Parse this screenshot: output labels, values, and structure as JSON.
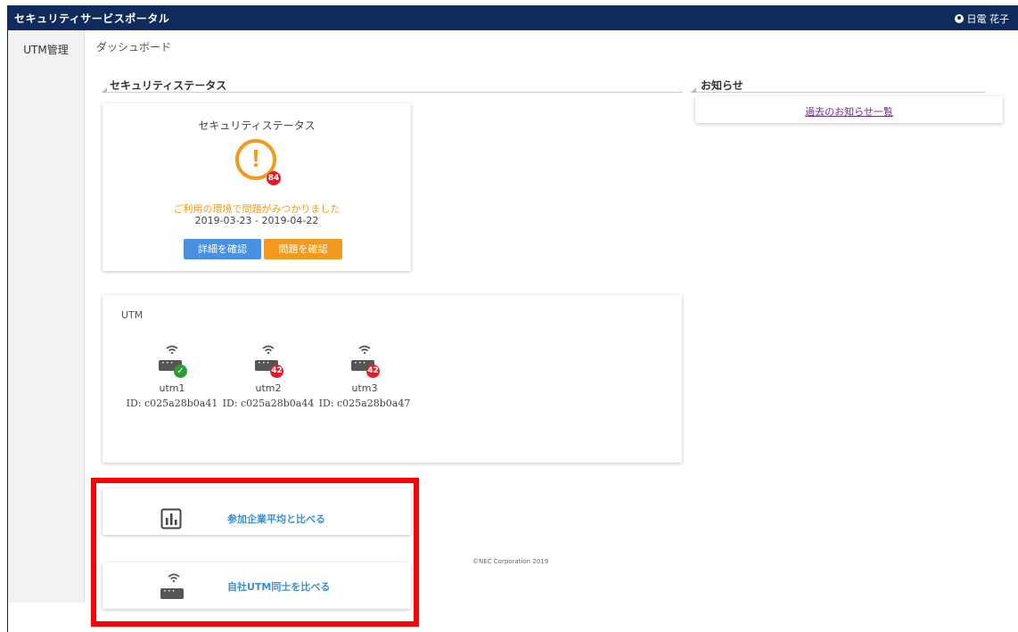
{
  "header": {
    "app_title": "セキュリティサービスポータル",
    "user_name": "日電 花子"
  },
  "sidebar": {
    "items": [
      {
        "label": "UTM管理"
      }
    ]
  },
  "breadcrumb": "ダッシュボード",
  "sections": {
    "security_status": "セキュリティステータス",
    "news": "お知らせ"
  },
  "status_card": {
    "title": "セキュリティステータス",
    "warning_mark": "!",
    "badge_count": "84",
    "message": "ご利用の環境で問題がみつかりました",
    "date_range": "2019-03-23 - 2019-04-22",
    "detail_button": "詳細を確認",
    "problem_button": "問題を確認"
  },
  "utm_card": {
    "label": "UTM",
    "devices": [
      {
        "name": "utm1",
        "id": "ID: c025a28b0a41",
        "status": "ok"
      },
      {
        "name": "utm2",
        "id": "ID: c025a28b0a44",
        "badge": "42"
      },
      {
        "name": "utm3",
        "id": "ID: c025a28b0a47",
        "badge": "42"
      }
    ]
  },
  "compare": {
    "industry_label": "参加企業平均と比べる",
    "own_utm_label": "自社UTM同士を比べる"
  },
  "news": {
    "past_link": "過去のお知らせ一覧"
  },
  "footer": {
    "copyright": "©NEC Corporation 2019"
  },
  "colors": {
    "header_bg": "#0f2a5c",
    "warning": "#f39a1e",
    "badge": "#e01e2a",
    "ok": "#2a9d3b",
    "primary_button": "#4a8fe0",
    "link": "#3a8fd0",
    "highlight": "#ff0000"
  },
  "icons": [
    "user-icon",
    "warning-icon",
    "wifi-icon",
    "router-icon",
    "check-icon",
    "bar-chart-icon"
  ]
}
